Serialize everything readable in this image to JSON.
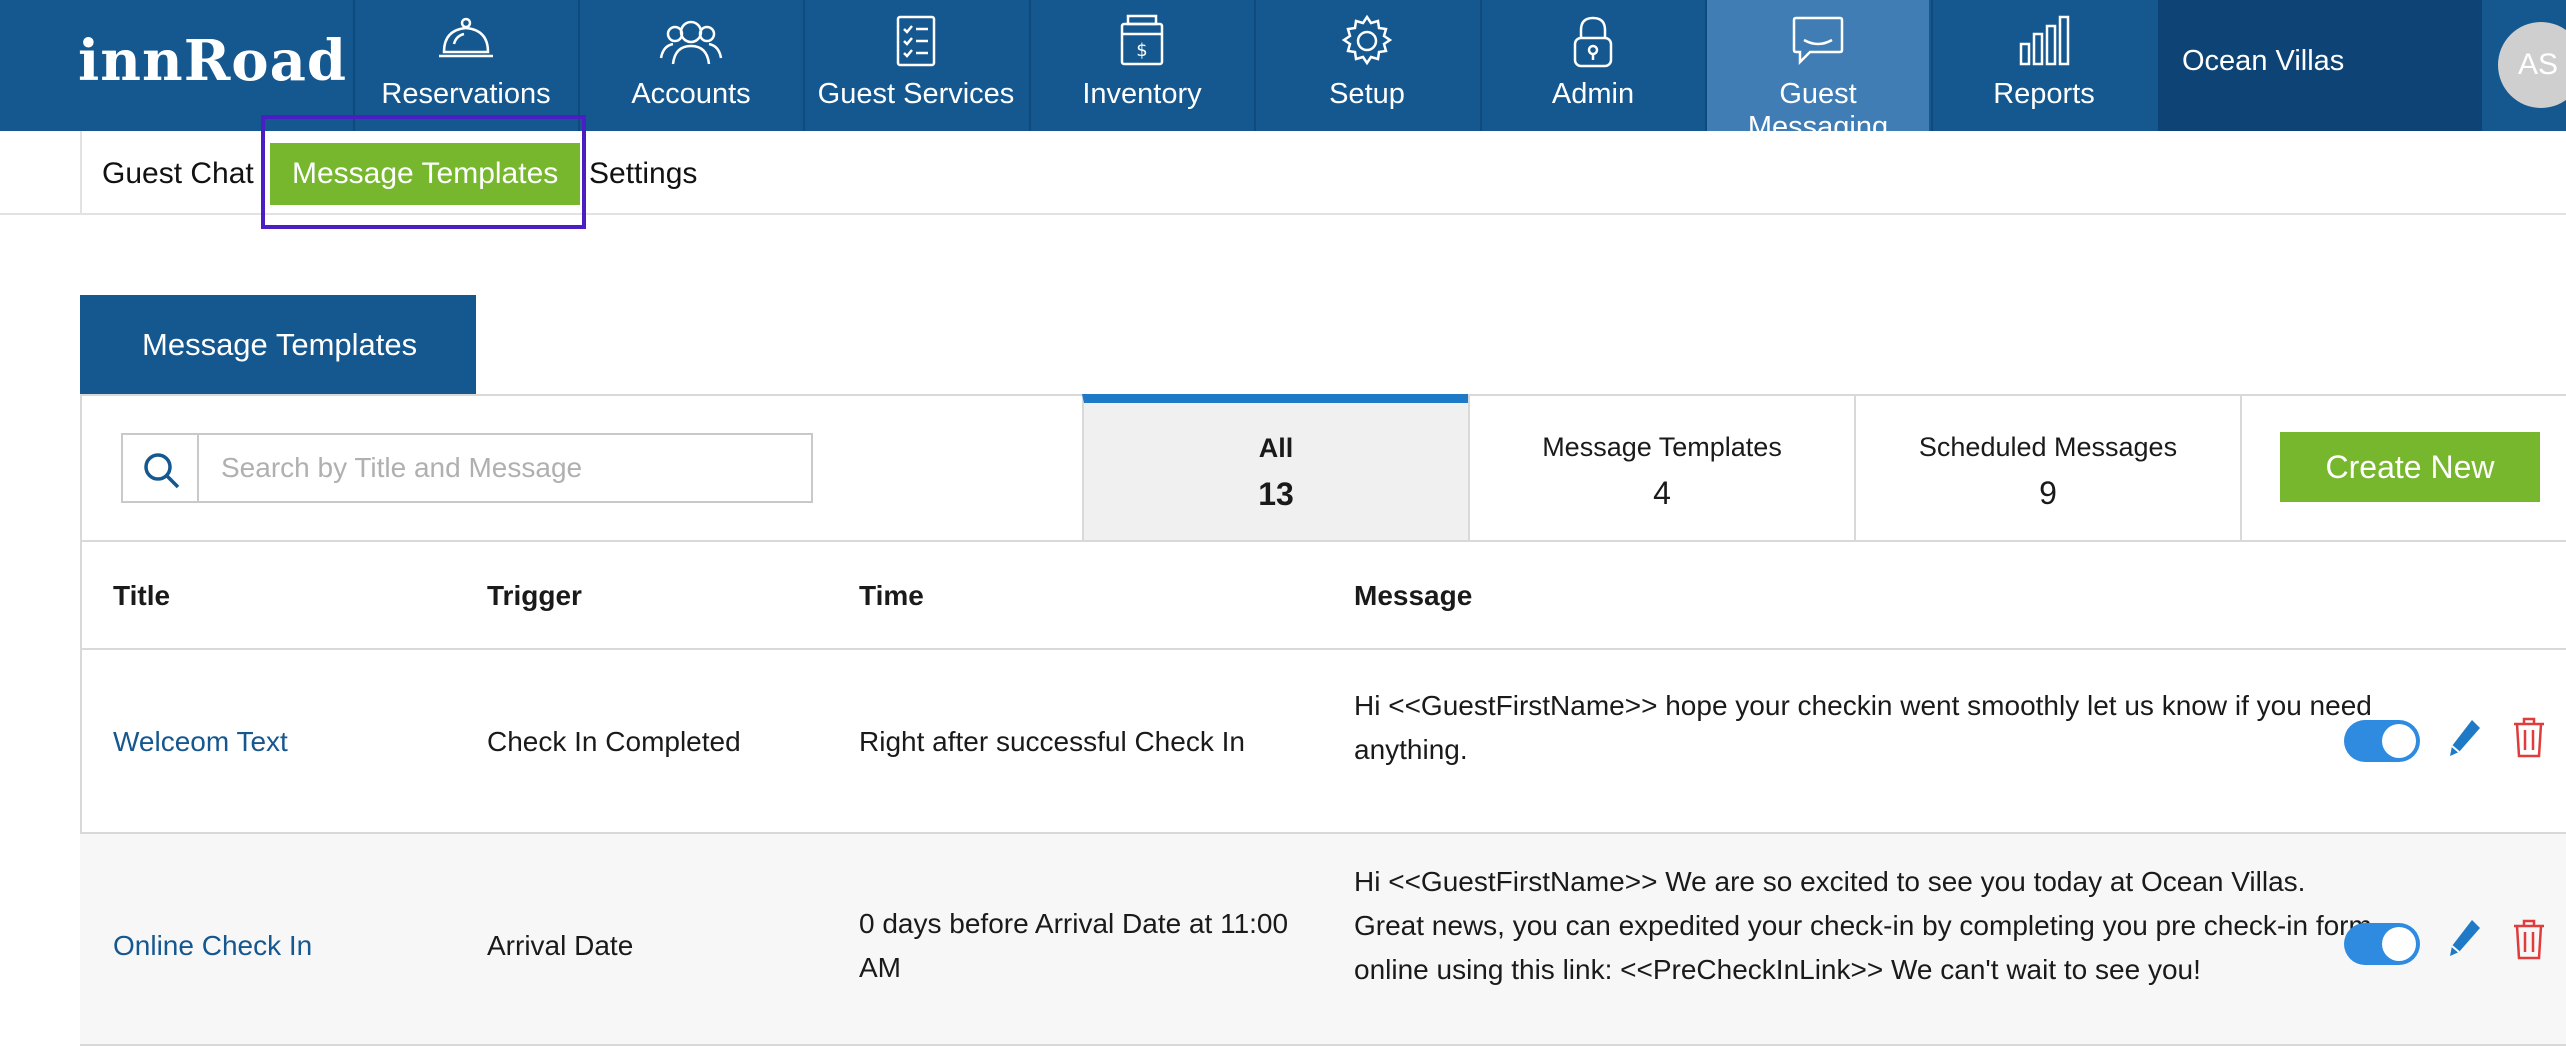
{
  "brand": {
    "logo": "innRoad"
  },
  "nav": {
    "items": [
      {
        "label": "Reservations",
        "icon": "bell-icon"
      },
      {
        "label": "Accounts",
        "icon": "users-icon"
      },
      {
        "label": "Guest Services",
        "icon": "checklist-icon"
      },
      {
        "label": "Inventory",
        "icon": "cash-register-icon"
      },
      {
        "label": "Setup",
        "icon": "gear-icon"
      },
      {
        "label": "Admin",
        "icon": "lock-icon"
      },
      {
        "label": "Guest Messaging",
        "icon": "chat-icon",
        "active": true
      },
      {
        "label": "Reports",
        "icon": "bar-chart-icon"
      }
    ],
    "property": "Ocean Villas",
    "user_initials": "AS"
  },
  "subnav": {
    "tabs": [
      {
        "label": "Guest Chat"
      },
      {
        "label": "Message Templates",
        "active": true
      },
      {
        "label": "Settings"
      }
    ]
  },
  "panel": {
    "title": "Message Templates",
    "search_placeholder": "Search by Title and Message",
    "filters": [
      {
        "label": "All",
        "count": "13",
        "active": true
      },
      {
        "label": "Message Templates",
        "count": "4"
      },
      {
        "label": "Scheduled Messages",
        "count": "9"
      }
    ],
    "create_button": "Create New"
  },
  "table": {
    "columns": [
      "Title",
      "Trigger",
      "Time",
      "Message"
    ],
    "rows": [
      {
        "title": "Welceom Text",
        "trigger": "Check In Completed",
        "time": "Right after successful Check In",
        "message": "Hi <<GuestFirstName>> hope your checkin went smoothly let us know if you need anything.",
        "enabled": true
      },
      {
        "title": "Online Check In",
        "trigger": "Arrival Date",
        "time": "0 days before Arrival Date at 11:00 AM",
        "message": "Hi <<GuestFirstName>> We are so excited to see you today at Ocean Villas. Great news, you can expedited your check-in by completing you pre check-in form online using this link: <<PreCheckInLink>> We can't wait to see you!",
        "enabled": true
      }
    ]
  },
  "colors": {
    "nav_bg": "#15578f",
    "nav_active": "#3f7db4",
    "green": "#76b72e",
    "toggle_on": "#2e8be0",
    "delete_red": "#e03c3c",
    "highlight": "#4b1ec4"
  }
}
